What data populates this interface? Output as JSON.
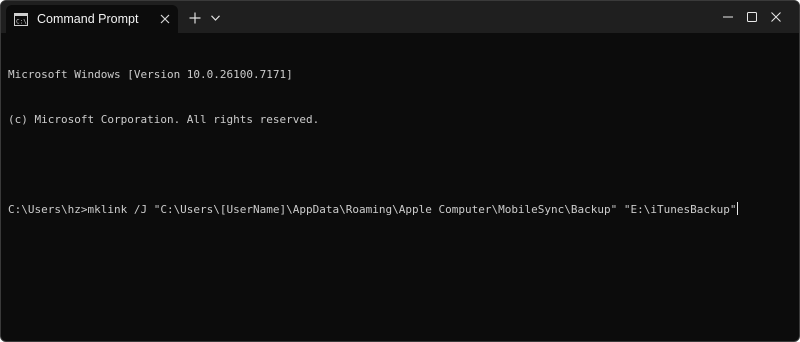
{
  "window": {
    "background": "#0c0c0c",
    "titlebar_background": "#1f1f1f"
  },
  "tab": {
    "title": "Command Prompt",
    "icon": "cmd-icon",
    "close_icon": "close-icon"
  },
  "toolbar": {
    "new_tab_icon": "plus-icon",
    "dropdown_icon": "chevron-down-icon"
  },
  "caption_buttons": {
    "minimize_icon": "minimize-icon",
    "maximize_icon": "maximize-icon",
    "close_icon": "close-icon"
  },
  "terminal": {
    "lines": [
      "Microsoft Windows [Version 10.0.26100.7171]",
      "(c) Microsoft Corporation. All rights reserved.",
      "",
      "C:\\Users\\hz>mklink /J \"C:\\Users\\[UserName]\\AppData\\Roaming\\Apple Computer\\MobileSync\\Backup\" \"E:\\iTunesBackup\""
    ],
    "text_color": "#cccccc"
  }
}
